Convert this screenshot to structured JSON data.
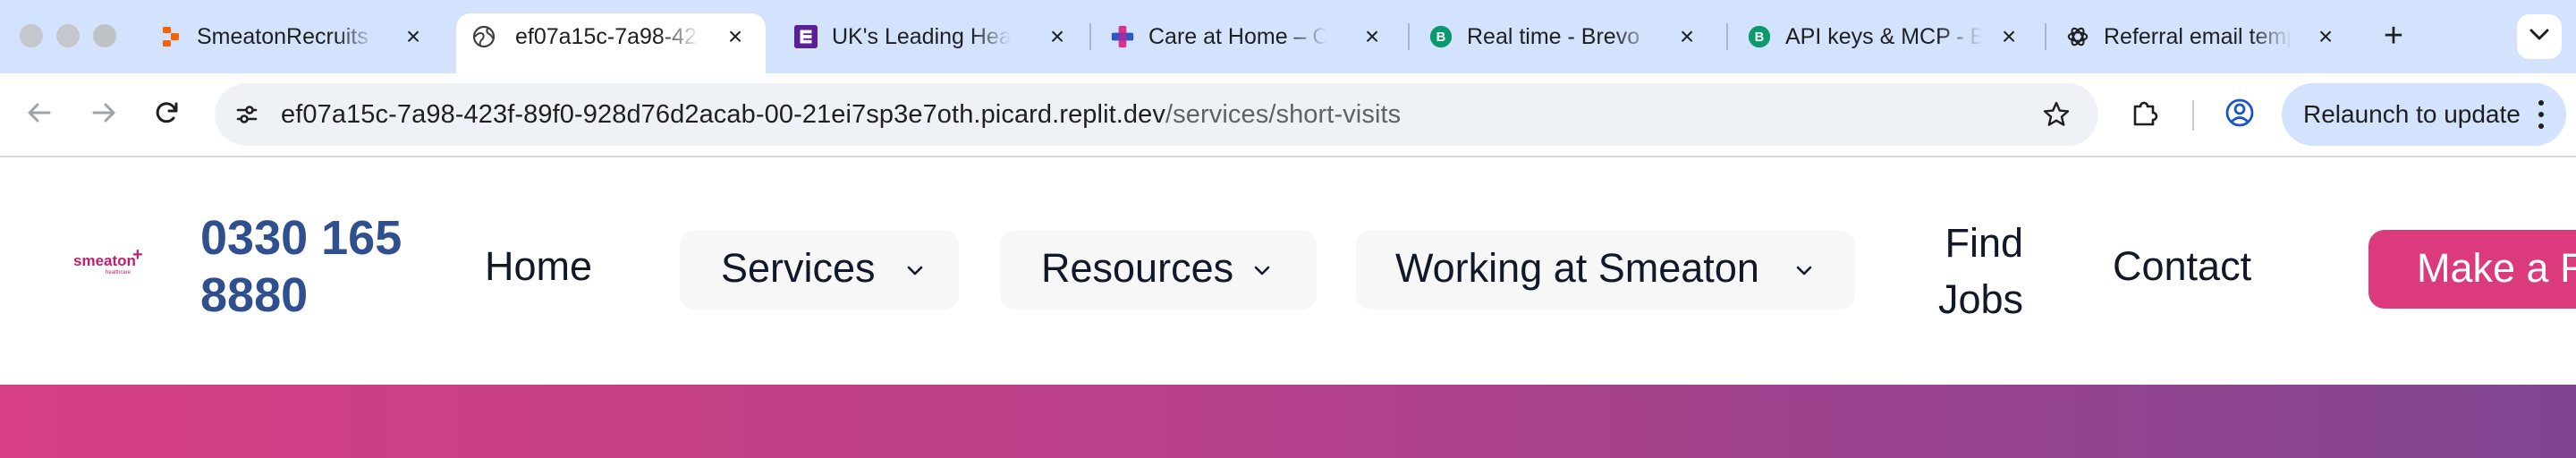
{
  "browser": {
    "tabs": [
      {
        "title": "SmeatonRecruits - ",
        "favicon": "replit-icon",
        "active": false
      },
      {
        "title": "ef07a15c-7a98-42",
        "favicon": "globe-icon",
        "active": true
      },
      {
        "title": "UK's Leading Healt",
        "favicon": "purple-logo-icon",
        "active": false
      },
      {
        "title": "Care at Home – Ca",
        "favicon": "medical-cross-icon",
        "active": false
      },
      {
        "title": "Real time - Brevo",
        "favicon": "brevo-icon",
        "active": false
      },
      {
        "title": "API keys & MCP - B",
        "favicon": "brevo-icon",
        "active": false
      },
      {
        "title": "Referral email temp",
        "favicon": "openai-icon",
        "active": false
      }
    ],
    "new_tab_label": "+",
    "address_bar": {
      "host": "ef07a15c-7a98-423f-89f0-928d76d2acab-00-21ei7sp3e7oth.picard.replit.dev",
      "path": "/services/short-visits"
    },
    "relaunch_label": "Relaunch to update",
    "colors": {
      "tabstrip": "#d3e3fd",
      "toolbar": "#ffffff",
      "omnibox": "#eef1f6"
    }
  },
  "site": {
    "logo": {
      "wordmark": "smeaton",
      "plus": "+",
      "sub": "healthcare"
    },
    "phone": "0330 165 8880",
    "nav": {
      "home": "Home",
      "services": "Services",
      "resources": "Resources",
      "working": "Working at Smeaton",
      "find_jobs": "Find Jobs",
      "contact": "Contact"
    },
    "cta_label": "Make a R",
    "colors": {
      "brand_pink": "#db3a7c",
      "phone_blue": "#2f4f8f",
      "hero_start": "#d63f83",
      "hero_end": "#7f4591"
    }
  }
}
